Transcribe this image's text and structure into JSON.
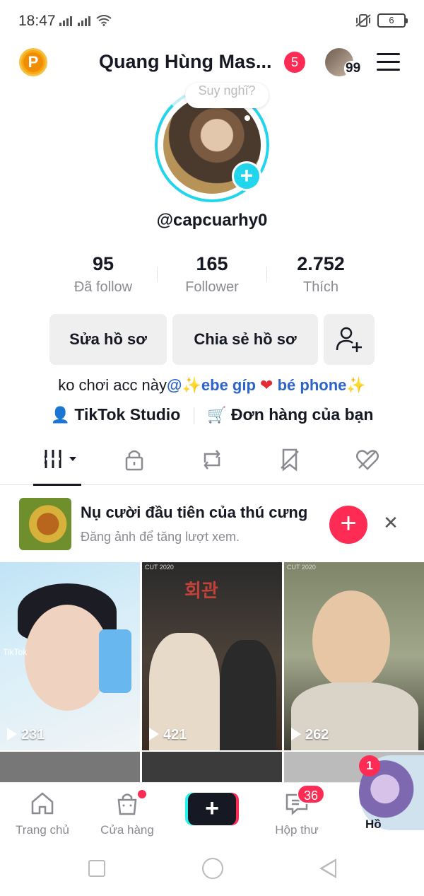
{
  "status": {
    "time": "18:47",
    "battery": "6"
  },
  "header": {
    "title": "Quang Hùng Mas...",
    "notif_count": "5",
    "mini_count": "99",
    "coin": "P"
  },
  "profile": {
    "bubble_text": "Suy nghĩ?",
    "username": "@capcuarhy0",
    "stats": [
      {
        "value": "95",
        "label": "Đã follow"
      },
      {
        "value": "165",
        "label": "Follower"
      },
      {
        "value": "2.752",
        "label": "Thích"
      }
    ],
    "buttons": {
      "edit": "Sửa hồ sơ",
      "share": "Chia sẻ hồ sơ"
    },
    "bio": {
      "text": "ko chơi acc này",
      "at": "@",
      "link1": "ebe gíp",
      "link2": "bé phone"
    },
    "links": {
      "studio": "TikTok Studio",
      "orders": "Đơn hàng của bạn"
    }
  },
  "banner": {
    "title": "Nụ cười đầu tiên của thú cưng",
    "subtitle": "Đăng ảnh để tăng lượt xem."
  },
  "videos": [
    {
      "views": "231",
      "tag": "TikTok"
    },
    {
      "views": "421",
      "tag": "CUT 2020",
      "sign": "회관"
    },
    {
      "views": "262",
      "tag": "CUT 2020"
    }
  ],
  "nav": {
    "home": "Trang chủ",
    "shop": "Cửa hàng",
    "inbox": "Hộp thư",
    "inbox_badge": "36",
    "profile": "Hồ",
    "profile_badge": "1"
  },
  "colors": {
    "accent": "#fe2c55",
    "cyan": "#20d5ec",
    "link": "#2d64c8"
  }
}
